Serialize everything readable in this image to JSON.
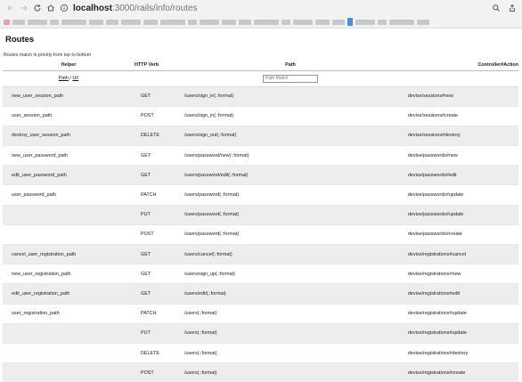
{
  "browser": {
    "url_host": "localhost",
    "url_path": ":3000/rails/info/routes"
  },
  "page": {
    "title": "Routes",
    "subtitle": "Routes match in priority from top to bottom"
  },
  "table": {
    "headers": {
      "helper": "Helper",
      "verb": "HTTP Verb",
      "path": "Path",
      "controller": "Controller#Action"
    },
    "filter": {
      "path_link": "Path",
      "separator": " / ",
      "url_link": "Url",
      "placeholder": "Path Match"
    },
    "rows": [
      {
        "helper": "new_user_session_path",
        "verb": "GET",
        "path": "/users/sign_in(.:format)",
        "controller": "devise/sessions#new"
      },
      {
        "helper": "user_session_path",
        "verb": "POST",
        "path": "/users/sign_in(.:format)",
        "controller": "devise/sessions#create"
      },
      {
        "helper": "destroy_user_session_path",
        "verb": "DELETE",
        "path": "/users/sign_out(.:format)",
        "controller": "devise/sessions#destroy"
      },
      {
        "helper": "new_user_password_path",
        "verb": "GET",
        "path": "/users/password/new(.:format)",
        "controller": "devise/passwords#new"
      },
      {
        "helper": "edit_user_password_path",
        "verb": "GET",
        "path": "/users/password/edit(.:format)",
        "controller": "devise/passwords#edit"
      },
      {
        "helper": "user_password_path",
        "verb": "PATCH",
        "path": "/users/password(.:format)",
        "controller": "devise/passwords#update"
      },
      {
        "helper": "",
        "verb": "PUT",
        "path": "/users/password(.:format)",
        "controller": "devise/passwords#update"
      },
      {
        "helper": "",
        "verb": "POST",
        "path": "/users/password(.:format)",
        "controller": "devise/passwords#create"
      },
      {
        "helper": "cancel_user_registration_path",
        "verb": "GET",
        "path": "/users/cancel(.:format)",
        "controller": "devise/registrations#cancel"
      },
      {
        "helper": "new_user_registration_path",
        "verb": "GET",
        "path": "/users/sign_up(.:format)",
        "controller": "devise/registrations#new"
      },
      {
        "helper": "edit_user_registration_path",
        "verb": "GET",
        "path": "/users/edit(.:format)",
        "controller": "devise/registrations#edit"
      },
      {
        "helper": "user_registration_path",
        "verb": "PATCH",
        "path": "/users(.:format)",
        "controller": "devise/registrations#update"
      },
      {
        "helper": "",
        "verb": "PUT",
        "path": "/users(.:format)",
        "controller": "devise/registrations#update"
      },
      {
        "helper": "",
        "verb": "DELETE",
        "path": "/users(.:format)",
        "controller": "devise/registrations#destroy"
      },
      {
        "helper": "",
        "verb": "POST",
        "path": "/users(.:format)",
        "controller": "devise/registrations#create"
      }
    ]
  },
  "icons": {
    "back": "arrow-left-icon",
    "forward": "arrow-right-icon",
    "reload": "reload-icon",
    "home": "home-icon",
    "site_info": "info-icon",
    "search": "search-icon",
    "share": "share-icon"
  },
  "colors": {
    "row_stripe": "#ededed",
    "chrome_bg": "#f2f2f2"
  }
}
